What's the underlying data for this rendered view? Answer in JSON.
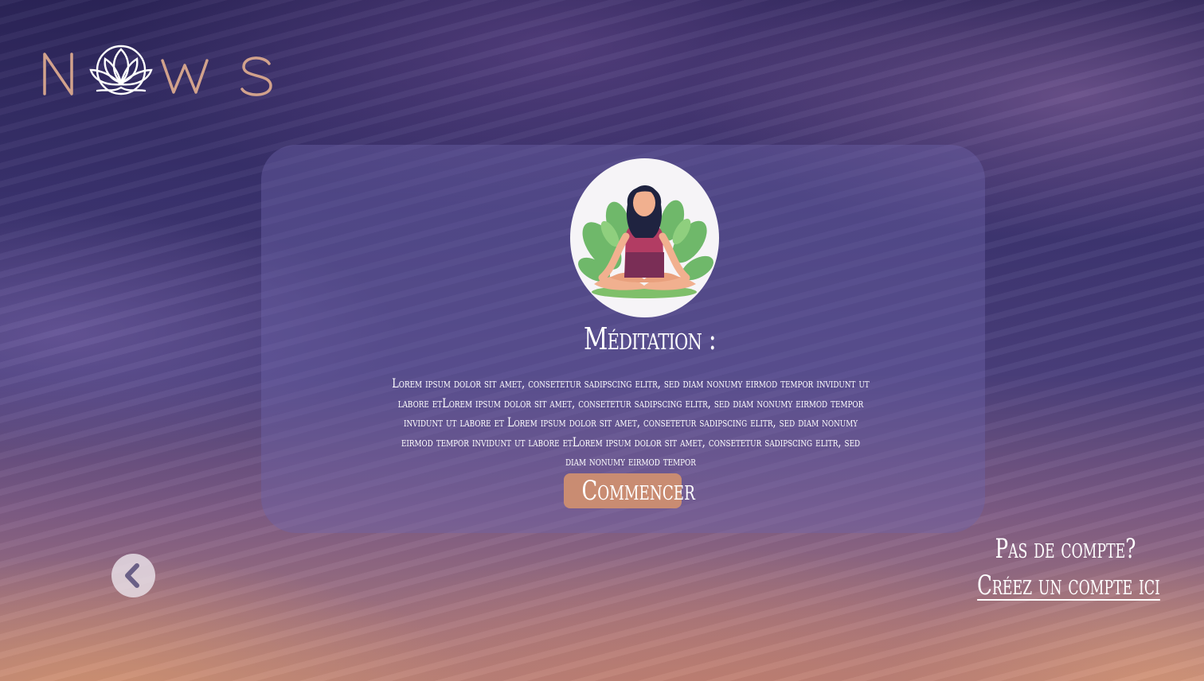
{
  "brand": {
    "logo_text": "NOWS",
    "colors": {
      "logo_accent": "#d2a28c",
      "button": "#c98c72",
      "card": "#6e64aa"
    }
  },
  "card": {
    "image_icon": "meditation-illustration",
    "title": "Méditation :",
    "description": "Lorem ipsum dolor sit amet, consetetur sadipscing elitr, sed diam nonumy eirmod tempor invidunt ut labore etLorem ipsum dolor sit amet, consetetur sadipscing elitr, sed diam nonumy eirmod tempor invidunt ut labore et Lorem ipsum dolor sit amet, consetetur sadipscing elitr, sed diam nonumy eirmod tempor invidunt ut labore etLorem ipsum dolor sit amet, consetetur sadipscing elitr, sed diam nonumy eirmod tempor",
    "start_label": "Commencer"
  },
  "nav": {
    "back_icon": "chevron-left-icon"
  },
  "account": {
    "prompt": "Pas de compte?",
    "create_link": "Créez un compte ici"
  }
}
